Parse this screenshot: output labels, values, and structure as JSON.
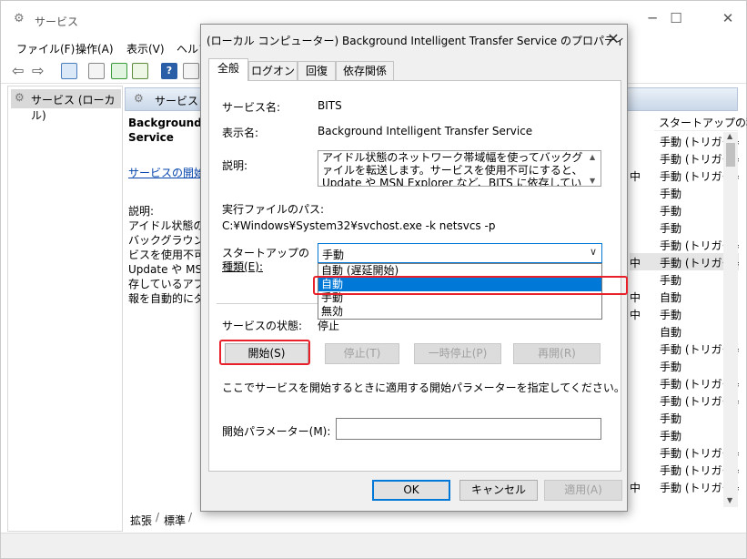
{
  "window": {
    "title": "サービス",
    "menu": [
      "ファイル(F)",
      "操作(A)",
      "表示(V)",
      "ヘルプ(H)"
    ]
  },
  "left_panel": {
    "selected_item": "サービス (ローカル)"
  },
  "mid_panel": {
    "header": "サービス (ローカル)",
    "service_name_lines": [
      "Background Intelligent Transfer",
      "Service"
    ],
    "start_link": "サービスの開始",
    "desc_label": "説明:",
    "desc_lines": [
      "アイドル状態のネットワーク帯域幅を使って",
      "バックグラウンドでファイルを転送します。サー",
      "ビスを使用不可にすると、Windows",
      "Update や MSN Explorer など、BITS に依",
      "存しているアプリケーションは、プログラムや情",
      "報を自動的にダウンロードできなくなります。"
    ]
  },
  "list": {
    "col_header": "スタートアップの種類",
    "rows": [
      {
        "status": "",
        "type": "手動 (トリガー開始)"
      },
      {
        "status": "",
        "type": "手動 (トリガー開始)"
      },
      {
        "status": "中",
        "type": "手動 (トリガー開始)"
      },
      {
        "status": "",
        "type": "手動"
      },
      {
        "status": "",
        "type": "手動"
      },
      {
        "status": "",
        "type": "手動"
      },
      {
        "status": "",
        "type": "手動 (トリガー開始)"
      },
      {
        "status": "中",
        "type": "手動 (トリガー開始)"
      },
      {
        "status": "",
        "type": "手動"
      },
      {
        "status": "中",
        "type": "自動"
      },
      {
        "status": "中",
        "type": "手動"
      },
      {
        "status": "",
        "type": "自動"
      },
      {
        "status": "",
        "type": "手動 (トリガー開始)"
      },
      {
        "status": "",
        "type": "手動"
      },
      {
        "status": "",
        "type": "手動 (トリガー開始)"
      },
      {
        "status": "",
        "type": "手動 (トリガー開始)"
      },
      {
        "status": "",
        "type": "手動"
      },
      {
        "status": "",
        "type": "手動"
      },
      {
        "status": "",
        "type": "手動 (トリガー開始)"
      },
      {
        "status": "",
        "type": "手動 (トリガー開始)"
      },
      {
        "status": "中",
        "type": "手動 (トリガー開始)"
      },
      {
        "status": "中",
        "type": "自動"
      },
      {
        "status": "",
        "type": "手動"
      }
    ]
  },
  "bottom_tabs": [
    "拡張",
    "標準"
  ],
  "dialog": {
    "title": "(ローカル コンピューター) Background Intelligent Transfer Service のプロパティ",
    "tabs": [
      "全般",
      "ログオン",
      "回復",
      "依存関係"
    ],
    "service_name_label": "サービス名:",
    "service_name": "BITS",
    "display_name_label": "表示名:",
    "display_name": "Background Intelligent Transfer Service",
    "description_label": "説明:",
    "description_lines": [
      "アイドル状態のネットワーク帯域幅を使ってバックグラウンドでフ",
      "ァイルを転送します。サービスを使用不可にすると、Windows",
      "Update や MSN Explorer など、BITS に依存しているアプリケ"
    ],
    "exe_path_label": "実行ファイルのパス:",
    "exe_path": "C:¥Windows¥System32¥svchost.exe -k netsvcs -p",
    "startup_type_label_1": "スタートアップの",
    "startup_type_label_2": "種類(E):",
    "startup_type_value": "手動",
    "startup_options": [
      "自動 (遅延開始)",
      "自動",
      "手動",
      "無効"
    ],
    "status_label": "サービスの状態:",
    "status_value": "停止",
    "buttons": {
      "start": "開始(S)",
      "stop": "停止(T)",
      "pause": "一時停止(P)",
      "resume": "再開(R)"
    },
    "hint": "ここでサービスを開始するときに適用する開始パラメーターを指定してください。",
    "param_label": "開始パラメーター(M):",
    "param_value": "",
    "ok": "OK",
    "cancel": "キャンセル",
    "apply": "適用(A)"
  },
  "colors": {
    "accent": "#0078d7",
    "highlight_box": "#e8202a"
  }
}
